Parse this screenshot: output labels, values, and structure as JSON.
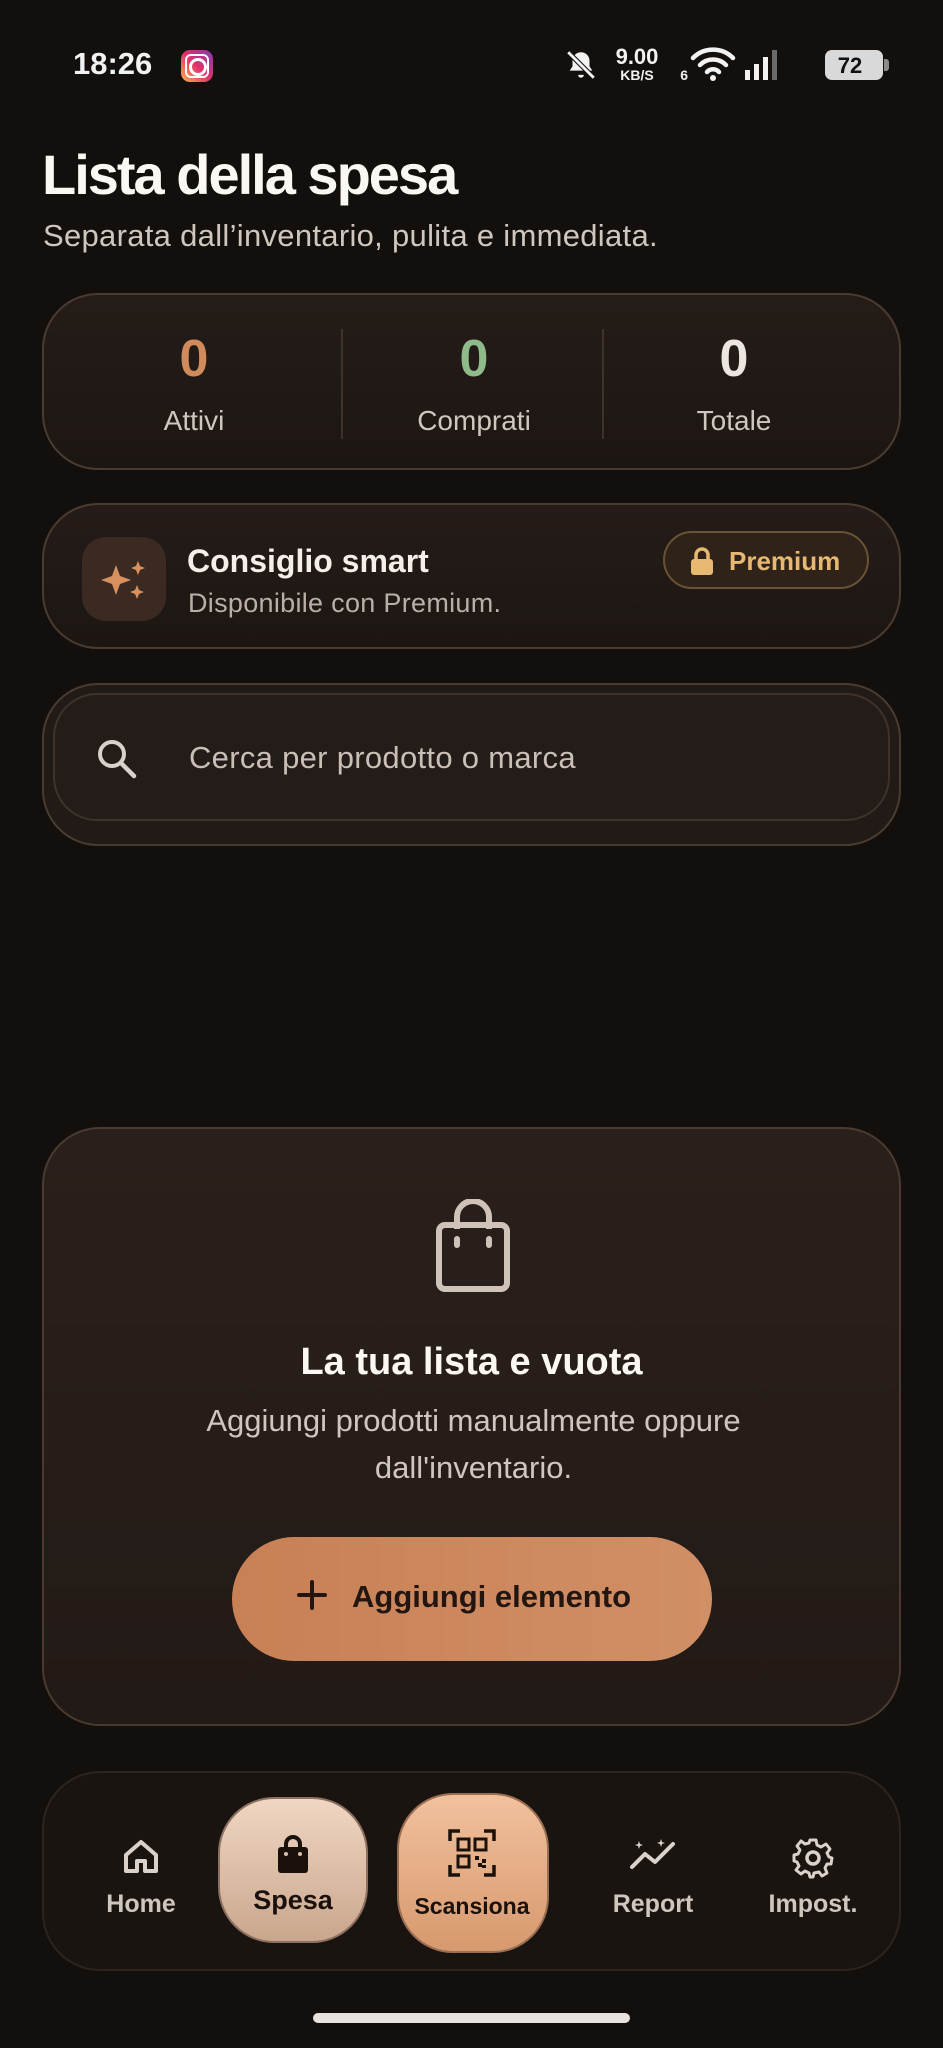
{
  "status_bar": {
    "time": "18:26",
    "net_speed_value": "9.00",
    "net_speed_unit": "KB/S",
    "wifi_badge": "6",
    "battery": "72"
  },
  "header": {
    "title": "Lista della spesa",
    "subtitle": "Separata dall’inventario, pulita e immediata."
  },
  "stats": [
    {
      "value": "0",
      "label": "Attivi",
      "color": "#d18a5c"
    },
    {
      "value": "0",
      "label": "Comprati",
      "color": "#8fba8a"
    },
    {
      "value": "0",
      "label": "Totale",
      "color": "#ece6e0"
    }
  ],
  "smart_tip": {
    "title": "Consiglio smart",
    "subtitle": "Disponibile con Premium.",
    "badge": "Premium",
    "icon": "sparkles-icon"
  },
  "search": {
    "placeholder": "Cerca per prodotto o marca",
    "value": ""
  },
  "empty_state": {
    "title": "La tua lista e vuota",
    "description": "Aggiungi prodotti manualmente oppure dall'inventario.",
    "button_label": "Aggiungi elemento",
    "icon": "shopping-bag-icon"
  },
  "bottom_nav": [
    {
      "label": "Home",
      "icon": "home-icon",
      "active": false
    },
    {
      "label": "Spesa",
      "icon": "shopping-bag-icon",
      "active": true
    },
    {
      "label": "Scansiona",
      "icon": "qr-code-icon",
      "active": false
    },
    {
      "label": "Report",
      "icon": "trend-chart-icon",
      "active": false
    },
    {
      "label": "Impost.",
      "icon": "gear-icon",
      "active": false
    }
  ],
  "colors": {
    "background": "#130f0d",
    "accent": "#d18f66",
    "premium": "#e7b872"
  }
}
